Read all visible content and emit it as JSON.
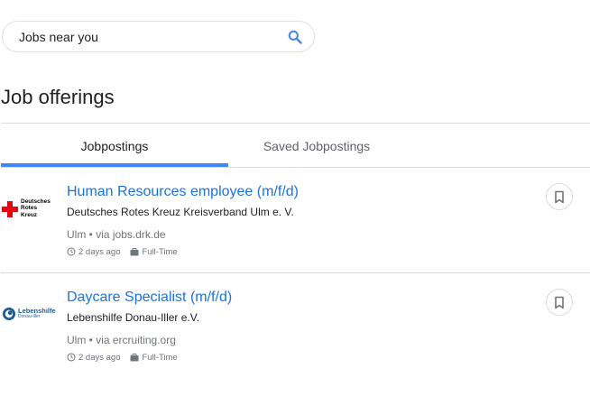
{
  "search": {
    "value": "Jobs near you",
    "icon": "search-icon",
    "accent": "#4285f4"
  },
  "page": {
    "title": "Job offerings"
  },
  "tabs": [
    {
      "label": "Jobpostings",
      "active": true
    },
    {
      "label": "Saved Jobpostings",
      "active": false
    }
  ],
  "colors": {
    "accent": "#4285f4",
    "link": "#1a73e8",
    "muted": "#70757a",
    "divider": "#dadce0"
  },
  "jobs": [
    {
      "logo_text": [
        "Deutsches",
        "Rotes",
        "Kreuz"
      ],
      "logo_icon": "red-cross-icon",
      "title": "Human Resources employee (m/f/d)",
      "employer": "Deutsches Rotes Kreuz Kreisverband Ulm e. V.",
      "location": "Ulm • via jobs.drk.de",
      "posted": "2 days ago",
      "type": "Full-Time",
      "saved": false
    },
    {
      "logo_text": [
        "Lebenshilfe",
        "Donau-Iller"
      ],
      "logo_icon": "lebenshilfe-icon",
      "title": "Daycare Specialist (m/f/d)",
      "employer": "Lebenshilfe Donau-Iller e.V.",
      "location": "Ulm • via ercruiting.org",
      "posted": "2 days ago",
      "type": "Full-Time",
      "saved": false
    }
  ]
}
